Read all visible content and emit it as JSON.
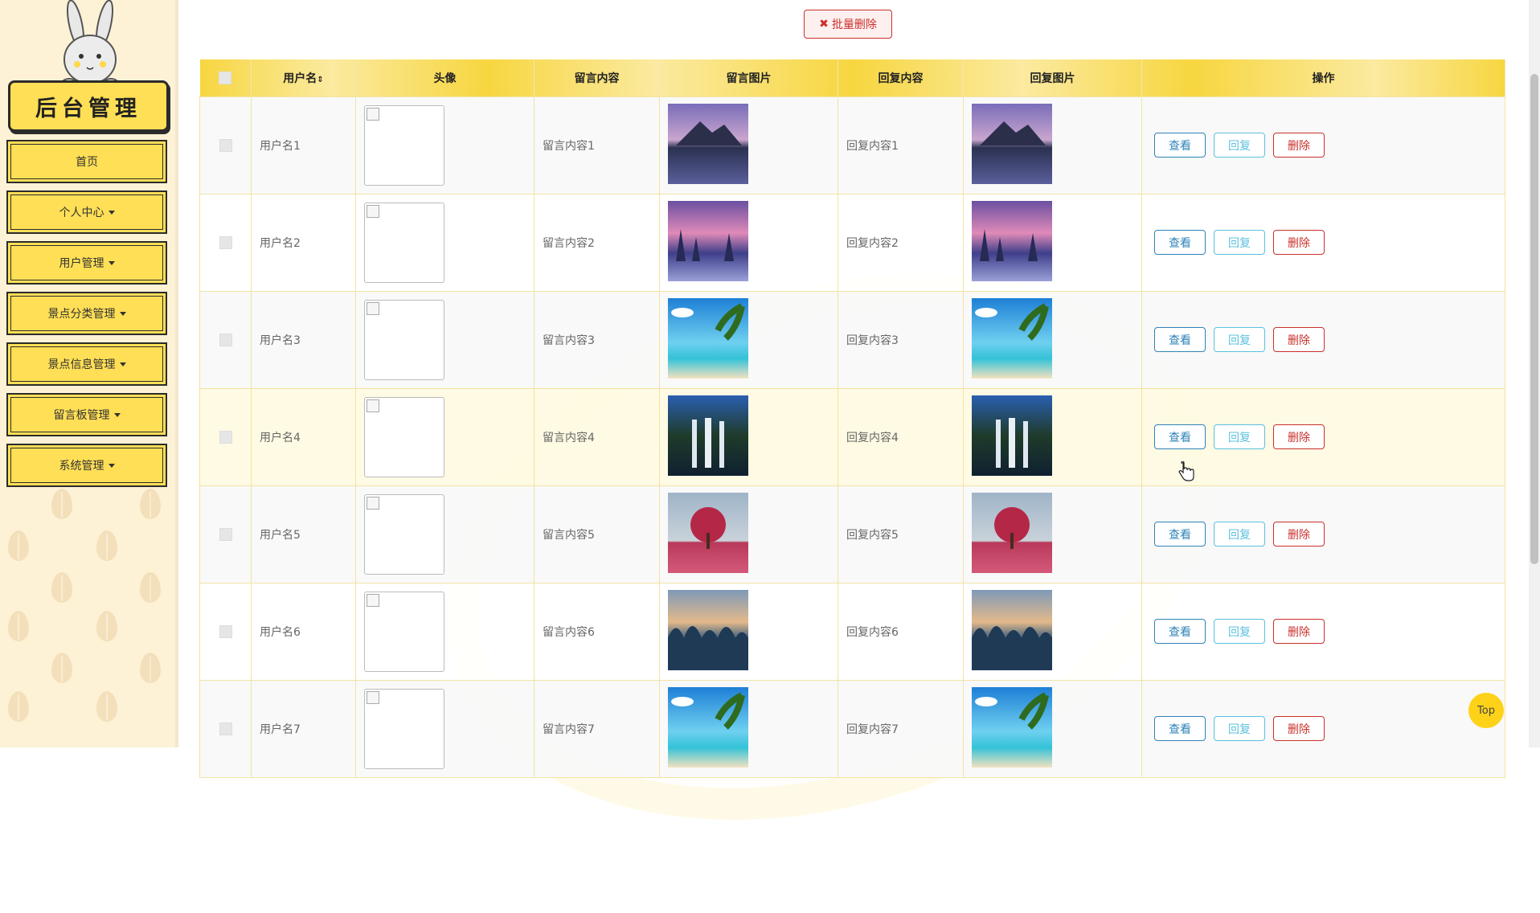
{
  "sidebar": {
    "title": "后台管理",
    "items": [
      {
        "label": "首页",
        "dropdown": false
      },
      {
        "label": "个人中心",
        "dropdown": true
      },
      {
        "label": "用户管理",
        "dropdown": true
      },
      {
        "label": "景点分类管理",
        "dropdown": true
      },
      {
        "label": "景点信息管理",
        "dropdown": true
      },
      {
        "label": "留言板管理",
        "dropdown": true
      },
      {
        "label": "系统管理",
        "dropdown": true
      }
    ]
  },
  "toolbar": {
    "bulk_delete_label": "批量删除",
    "bulk_delete_icon": "close-icon"
  },
  "table": {
    "headers": [
      "用户名",
      "头像",
      "留言内容",
      "留言图片",
      "回复内容",
      "回复图片",
      "操作"
    ],
    "sortable_header_icon": "sort-icon",
    "rows": [
      {
        "username": "用户名1",
        "message": "留言内容1",
        "reply": "回复内容1",
        "image": "mountain-lake"
      },
      {
        "username": "用户名2",
        "message": "留言内容2",
        "reply": "回复内容2",
        "image": "snowy-forest-sunset"
      },
      {
        "username": "用户名3",
        "message": "留言内容3",
        "reply": "回复内容3",
        "image": "tropical-beach"
      },
      {
        "username": "用户名4",
        "message": "留言内容4",
        "reply": "回复内容4",
        "image": "waterfall"
      },
      {
        "username": "用户名5",
        "message": "留言内容5",
        "reply": "回复内容5",
        "image": "pink-tree"
      },
      {
        "username": "用户名6",
        "message": "留言内容6",
        "reply": "回复内容6",
        "image": "karst-mountains"
      },
      {
        "username": "用户名7",
        "message": "留言内容7",
        "reply": "回复内容7",
        "image": "tropical-beach"
      }
    ],
    "actions": {
      "view": "查看",
      "reply": "回复",
      "delete": "删除"
    }
  },
  "top_button": "Top",
  "colors": {
    "accent": "#ffdf55",
    "sidebar_bg": "#fdf2d6",
    "danger": "#c9302c",
    "primary": "#2e83b8",
    "info": "#5bc0de"
  }
}
